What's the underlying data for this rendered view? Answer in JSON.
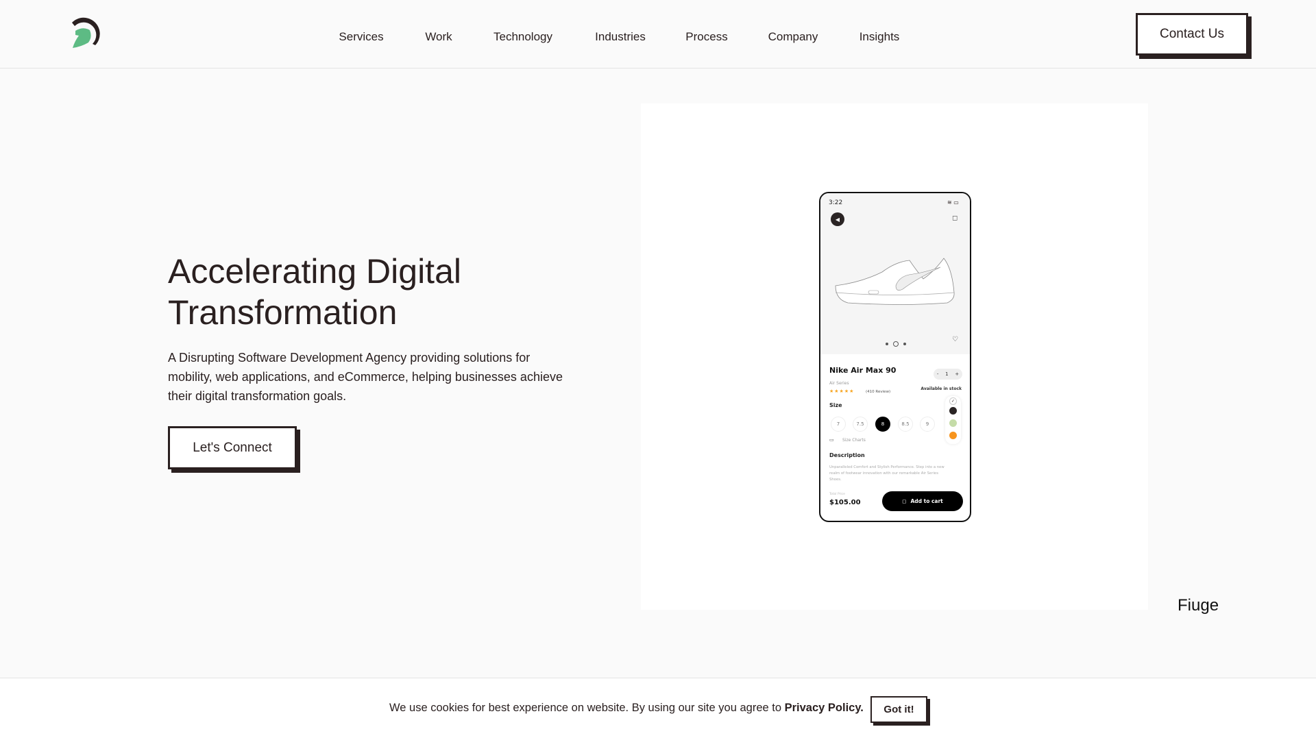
{
  "header": {
    "logo": "helmet-logo",
    "nav": [
      "Services",
      "Work",
      "Technology",
      "Industries",
      "Process",
      "Company",
      "Insights"
    ],
    "contact_label": "Contact Us"
  },
  "hero": {
    "title_line1": "Accelerating Digital",
    "title_line2": "Transformation",
    "description": "A Disrupting Software Development Agency providing solutions for mobility, web applications, and eCommerce, helping businesses achieve their digital transformation goals.",
    "cta_label": "Let's Connect"
  },
  "phone": {
    "time": "3:22",
    "product_name": "Nike Air Max 90",
    "series": "Air Series",
    "reviews": "(410 Review)",
    "rating": 5,
    "quantity": "1",
    "minus": "-",
    "plus": "+",
    "stock": "Available in stock",
    "size_label": "Size",
    "sizes": [
      "7",
      "7.5",
      "8",
      "8.5",
      "9"
    ],
    "selected_size": "8",
    "size_charts": "Size Charts",
    "colors": [
      "#ffffff",
      "#2a2424",
      "#c5dca8",
      "#f7941d"
    ],
    "description_label": "Description",
    "description": "Unparalleled Comfort and Stylish Performance. Step into a new realm of footwear innovation with our remarkable Air Series Shoes.",
    "total_label": "Total Price",
    "price": "$105.00",
    "add_to_cart": "Add to cart"
  },
  "caption": "Fiuge",
  "cookie": {
    "text": "We use cookies for best experience on website. By using our site you agree to ",
    "link": "Privacy Policy.",
    "button": "Got it!"
  },
  "colors": {
    "brand_dark": "#2a2020",
    "brand_green": "#5dbb84"
  }
}
